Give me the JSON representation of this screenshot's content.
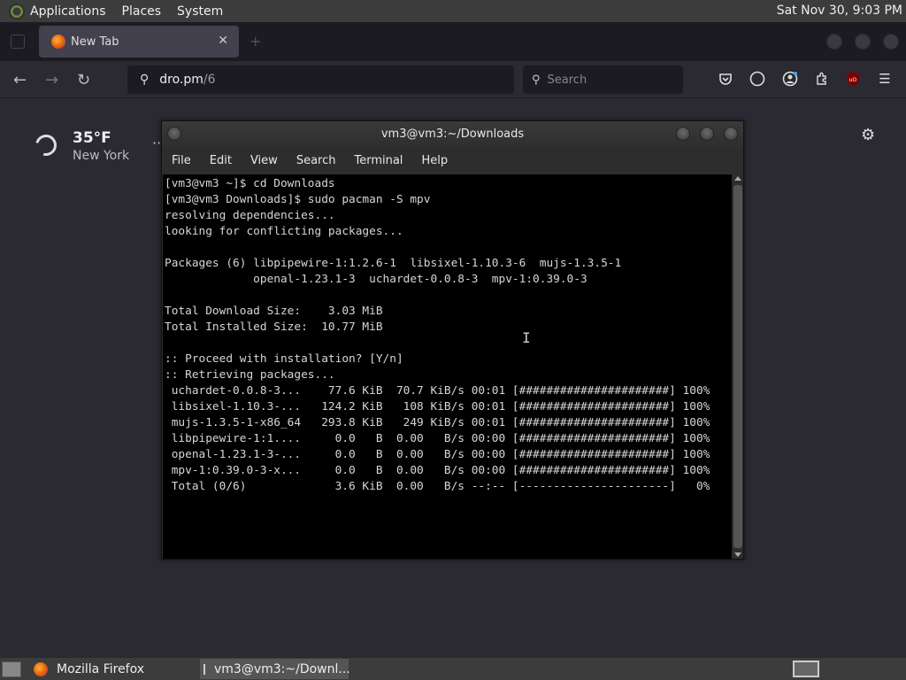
{
  "top_panel": {
    "menus": [
      "Applications",
      "Places",
      "System"
    ],
    "clock": "Sat Nov 30,  9:03 PM"
  },
  "browser": {
    "tab_title": "New Tab",
    "url_host": "dro.pm",
    "url_path": "/6",
    "search_placeholder": "Search"
  },
  "newtab": {
    "temperature": "35°F",
    "city": "New York"
  },
  "terminal": {
    "title": "vm3@vm3:~/Downloads",
    "menu": [
      "File",
      "Edit",
      "View",
      "Search",
      "Terminal",
      "Help"
    ],
    "lines": [
      "[vm3@vm3 ~]$ cd Downloads",
      "[vm3@vm3 Downloads]$ sudo pacman -S mpv",
      "resolving dependencies...",
      "looking for conflicting packages...",
      "",
      "Packages (6) libpipewire-1:1.2.6-1  libsixel-1.10.3-6  mujs-1.3.5-1",
      "             openal-1.23.1-3  uchardet-0.0.8-3  mpv-1:0.39.0-3",
      "",
      "Total Download Size:    3.03 MiB",
      "Total Installed Size:  10.77 MiB",
      "",
      ":: Proceed with installation? [Y/n]",
      ":: Retrieving packages...",
      " uchardet-0.0.8-3...    77.6 KiB  70.7 KiB/s 00:01 [######################] 100%",
      " libsixel-1.10.3-...   124.2 KiB   108 KiB/s 00:01 [######################] 100%",
      " mujs-1.3.5-1-x86_64   293.8 KiB   249 KiB/s 00:01 [######################] 100%",
      " libpipewire-1:1....     0.0   B  0.00   B/s 00:00 [######################] 100%",
      " openal-1.23.1-3-...     0.0   B  0.00   B/s 00:00 [######################] 100%",
      " mpv-1:0.39.0-3-x...     0.0   B  0.00   B/s 00:00 [######################] 100%",
      " Total (0/6)             3.6 KiB  0.00   B/s --:-- [----------------------]   0%"
    ]
  },
  "taskbar": {
    "firefox_label": "Mozilla Firefox",
    "terminal_label": "vm3@vm3:~/Downl..."
  },
  "icons": {
    "back": "←",
    "forward": "→",
    "reload": "↻",
    "search": "⚲",
    "close": "✕",
    "menu": "☰",
    "gear": "⚙",
    "plus": "+"
  }
}
